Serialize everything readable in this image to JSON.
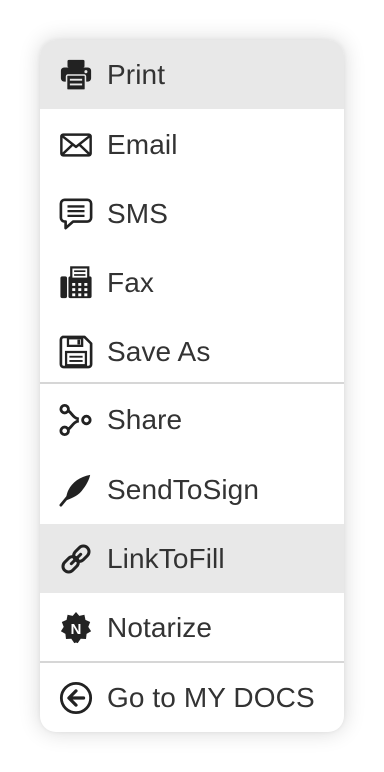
{
  "menu": {
    "items": [
      {
        "label": "Print",
        "icon": "printer-icon"
      },
      {
        "label": "Email",
        "icon": "envelope-icon"
      },
      {
        "label": "SMS",
        "icon": "message-icon"
      },
      {
        "label": "Fax",
        "icon": "fax-icon"
      },
      {
        "label": "Save As",
        "icon": "floppy-disk-icon"
      },
      {
        "label": "Share",
        "icon": "share-icon"
      },
      {
        "label": "SendToSign",
        "icon": "feather-icon"
      },
      {
        "label": "LinkToFill",
        "icon": "link-icon"
      },
      {
        "label": "Notarize",
        "icon": "notary-seal-icon"
      },
      {
        "label": "Go to MY DOCS",
        "icon": "arrow-circle-left-icon"
      }
    ]
  },
  "colors": {
    "text": "#333333",
    "icon": "#222222",
    "highlight": "#e8e8e8",
    "divider": "#d6d6d6",
    "background": "#ffffff"
  }
}
